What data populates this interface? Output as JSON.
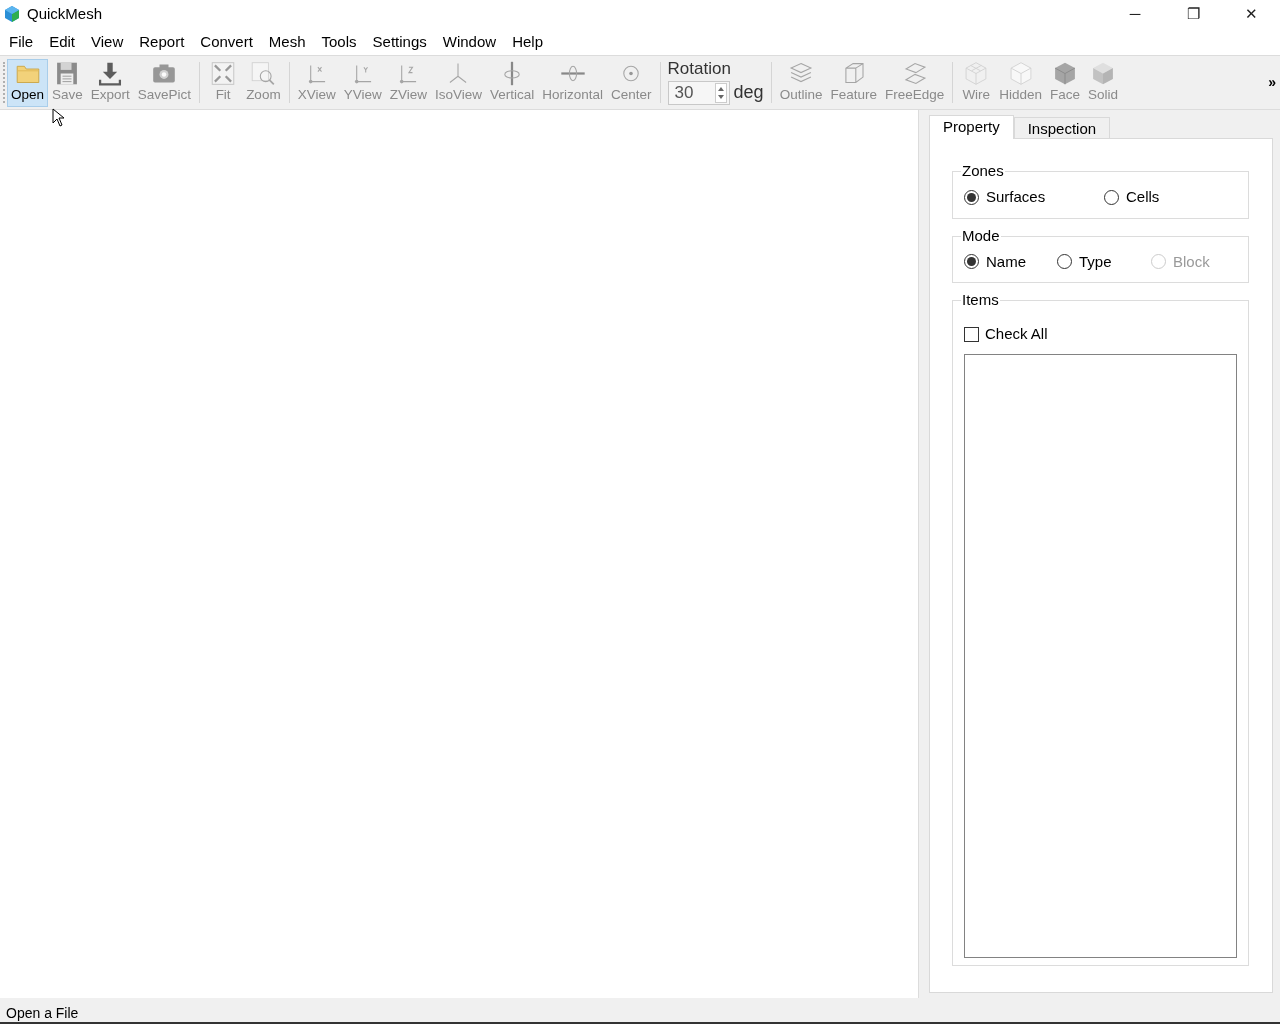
{
  "window": {
    "title": "QuickMesh",
    "controls": [
      "─",
      "❐",
      "✕"
    ]
  },
  "menu": [
    "File",
    "Edit",
    "View",
    "Report",
    "Convert",
    "Mesh",
    "Tools",
    "Settings",
    "Window",
    "Help"
  ],
  "toolbar": {
    "groups": [
      [
        {
          "label": "Open",
          "disabled": false,
          "highlighted": true
        },
        {
          "label": "Save",
          "disabled": true,
          "highlighted": false
        },
        {
          "label": "Export",
          "disabled": true,
          "highlighted": false
        },
        {
          "label": "SavePict",
          "disabled": true,
          "highlighted": false
        }
      ],
      [
        {
          "label": "Fit",
          "disabled": true,
          "highlighted": false
        },
        {
          "label": "Zoom",
          "disabled": true,
          "highlighted": false
        }
      ],
      [
        {
          "label": "XView",
          "disabled": true,
          "highlighted": false
        },
        {
          "label": "YView",
          "disabled": true,
          "highlighted": false
        },
        {
          "label": "ZView",
          "disabled": true,
          "highlighted": false
        },
        {
          "label": "IsoView",
          "disabled": true,
          "highlighted": false
        },
        {
          "label": "Vertical",
          "disabled": true,
          "highlighted": false
        },
        {
          "label": "Horizontal",
          "disabled": true,
          "highlighted": false
        },
        {
          "label": "Center",
          "disabled": true,
          "highlighted": false
        }
      ]
    ],
    "rotation": {
      "label": "Rotation",
      "value": "30",
      "unit": "deg"
    },
    "groups_after": [
      [
        {
          "label": "Outline",
          "disabled": true,
          "highlighted": false
        },
        {
          "label": "Feature",
          "disabled": true,
          "highlighted": false
        },
        {
          "label": "FreeEdge",
          "disabled": true,
          "highlighted": false
        }
      ],
      [
        {
          "label": "Wire",
          "disabled": true,
          "highlighted": false
        },
        {
          "label": "Hidden",
          "disabled": true,
          "highlighted": false
        },
        {
          "label": "Face",
          "disabled": true,
          "highlighted": false
        },
        {
          "label": "Solid",
          "disabled": true,
          "highlighted": false
        }
      ]
    ],
    "overflow": "»"
  },
  "panel": {
    "tabs": [
      {
        "label": "Property",
        "selected": true
      },
      {
        "label": "Inspection",
        "selected": false
      }
    ],
    "zones": {
      "title": "Zones",
      "options": [
        {
          "label": "Surfaces",
          "selected": true,
          "disabled": false
        },
        {
          "label": "Cells",
          "selected": false,
          "disabled": false
        }
      ]
    },
    "mode": {
      "title": "Mode",
      "options": [
        {
          "label": "Name",
          "selected": true,
          "disabled": false
        },
        {
          "label": "Type",
          "selected": false,
          "disabled": false
        },
        {
          "label": "Block",
          "selected": false,
          "disabled": true
        }
      ]
    },
    "items": {
      "title": "Items",
      "check_all": {
        "label": "Check All",
        "checked": false
      }
    }
  },
  "status_bar": "Open a File"
}
